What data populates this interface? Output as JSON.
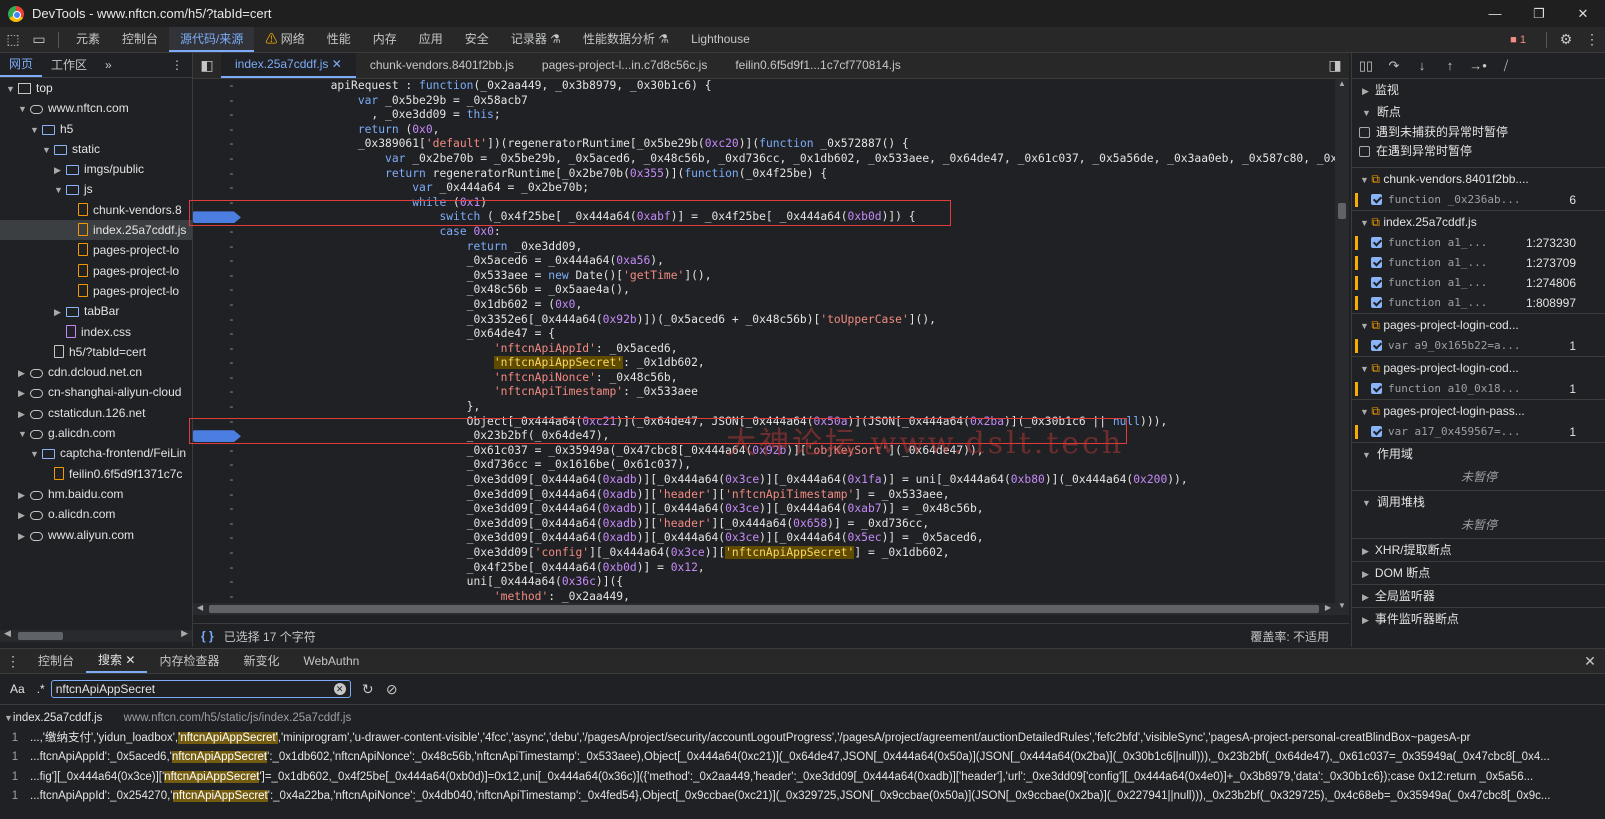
{
  "window": {
    "title": "DevTools - www.nftcn.com/h5/?tabId=cert",
    "buttons": [
      "—",
      "❐",
      "✕"
    ]
  },
  "main_tabs": {
    "items": [
      "元素",
      "控制台",
      "源代码/来源",
      "网络",
      "性能",
      "内存",
      "应用",
      "安全",
      "记录器",
      "性能数据分析",
      "Lighthouse"
    ],
    "issues_count": "1"
  },
  "navigator": {
    "tabs": [
      "网页",
      "工作区"
    ],
    "tree": [
      {
        "label": "top",
        "indent": 0,
        "icon": "frame",
        "arrow": "▼"
      },
      {
        "label": "www.nftcn.com",
        "indent": 1,
        "icon": "cloud",
        "arrow": "▼"
      },
      {
        "label": "h5",
        "indent": 2,
        "icon": "folder",
        "arrow": "▼"
      },
      {
        "label": "static",
        "indent": 3,
        "icon": "folder",
        "arrow": "▼"
      },
      {
        "label": "imgs/public",
        "indent": 4,
        "icon": "folder",
        "arrow": "▶"
      },
      {
        "label": "js",
        "indent": 4,
        "icon": "folder",
        "arrow": "▼"
      },
      {
        "label": "chunk-vendors.8",
        "indent": 5,
        "icon": "file",
        "arrow": ""
      },
      {
        "label": "index.25a7cddf.js",
        "indent": 5,
        "icon": "file",
        "arrow": "",
        "selected": true
      },
      {
        "label": "pages-project-lo",
        "indent": 5,
        "icon": "file",
        "arrow": ""
      },
      {
        "label": "pages-project-lo",
        "indent": 5,
        "icon": "file",
        "arrow": ""
      },
      {
        "label": "pages-project-lo",
        "indent": 5,
        "icon": "file",
        "arrow": ""
      },
      {
        "label": "tabBar",
        "indent": 4,
        "icon": "folder",
        "arrow": "▶"
      },
      {
        "label": "index.css",
        "indent": 4,
        "icon": "css",
        "arrow": ""
      },
      {
        "label": "h5/?tabId=cert",
        "indent": 3,
        "icon": "doc",
        "arrow": ""
      },
      {
        "label": "cdn.dcloud.net.cn",
        "indent": 1,
        "icon": "cloud",
        "arrow": "▶"
      },
      {
        "label": "cn-shanghai-aliyun-cloud",
        "indent": 1,
        "icon": "cloud",
        "arrow": "▶"
      },
      {
        "label": "cstaticdun.126.net",
        "indent": 1,
        "icon": "cloud",
        "arrow": "▶"
      },
      {
        "label": "g.alicdn.com",
        "indent": 1,
        "icon": "cloud",
        "arrow": "▼"
      },
      {
        "label": "captcha-frontend/FeiLin",
        "indent": 2,
        "icon": "folder",
        "arrow": "▼"
      },
      {
        "label": "feilin0.6f5d9f1371c7c",
        "indent": 3,
        "icon": "file",
        "arrow": ""
      },
      {
        "label": "hm.baidu.com",
        "indent": 1,
        "icon": "cloud",
        "arrow": "▶"
      },
      {
        "label": "o.alicdn.com",
        "indent": 1,
        "icon": "cloud",
        "arrow": "▶"
      },
      {
        "label": "www.aliyun.com",
        "indent": 1,
        "icon": "cloud",
        "arrow": "▶"
      }
    ]
  },
  "editor": {
    "tabs": [
      "index.25a7cddf.js",
      "chunk-vendors.8401f2bb.js",
      "pages-project-l...in.c7d8c56c.js",
      "feilin0.6f5d9f1...1c7cf770814.js"
    ],
    "lines": [
      {
        "g": "-",
        "t": "            apiRequest : function(_0x2aa449, _0x3b8979, _0x30b1c6) {"
      },
      {
        "g": "-",
        "t": "                var _0x5be29b = _0x58acb7"
      },
      {
        "g": "-",
        "t": "                  , _0xe3dd09 = this;"
      },
      {
        "g": "-",
        "t": "                return (0x0,"
      },
      {
        "g": "-",
        "t": "                _0x389061['default'])(regeneratorRuntime[_0x5be29b(0xc20)](function _0x572887() {"
      },
      {
        "g": "-",
        "t": "                    var _0x2be70b = _0x5be29b, _0x5aced6, _0x48c56b, _0xd736cc, _0x1db602, _0x533aee, _0x64de47, _0x61c037, _0x5a56de, _0x3aa0eb, _0x587c80, _0x3b"
      },
      {
        "g": "-",
        "t": "                    return regeneratorRuntime[_0x2be70b(0x355)](function(_0x4f25be) {"
      },
      {
        "g": "-",
        "t": "                        var _0x444a64 = _0x2be70b;"
      },
      {
        "g": "-",
        "t": "                        while (0x1)"
      },
      {
        "g": "-",
        "t": "                            switch (_0x4f25be[ _0x444a64(0xabf)] = _0x4f25be[ _0x444a64(0xb0d)]) {",
        "bp": true
      },
      {
        "g": "-",
        "t": "                            case 0x0:"
      },
      {
        "g": "-",
        "t": "                                return _0xe3dd09,"
      },
      {
        "g": "-",
        "t": "                                _0x5aced6 = _0x444a64(0xa56),"
      },
      {
        "g": "-",
        "t": "                                _0x533aee = new Date()['getTime'](),"
      },
      {
        "g": "-",
        "t": "                                _0x48c56b = _0x5aae4a(),"
      },
      {
        "g": "-",
        "t": "                                _0x1db602 = (0x0,"
      },
      {
        "g": "-",
        "t": "                                _0x3352e6[_0x444a64(0x92b)])(_0x5aced6 + _0x48c56b)['toUpperCase'](),"
      },
      {
        "g": "-",
        "t": "                                _0x64de47 = {"
      },
      {
        "g": "-",
        "t": "                                    'nftcnApiAppId': _0x5aced6,"
      },
      {
        "g": "-",
        "t": "                                    'nftcnApiAppSecret': _0x1db602,"
      },
      {
        "g": "-",
        "t": "                                    'nftcnApiNonce': _0x48c56b,"
      },
      {
        "g": "-",
        "t": "                                    'nftcnApiTimestamp': _0x533aee"
      },
      {
        "g": "-",
        "t": "                                },"
      },
      {
        "g": "-",
        "t": "                                Object[_0x444a64(0xc21)](_0x64de47, JSON[_0x444a64(0x50a)](JSON[_0x444a64(0x2ba)](_0x30b1c6 || null))),"
      },
      {
        "g": "-",
        "t": "                                _0x23b2bf(_0x64de47),",
        "bp": true
      },
      {
        "g": "-",
        "t": "                                _0x61c037 = _0x35949a(_0x47cbc8[_0x444a64(0x92b)]['objKeySort'](_0x64de47)),"
      },
      {
        "g": "-",
        "t": "                                _0xd736cc = _0x1616be(_0x61c037),"
      },
      {
        "g": "-",
        "t": "                                _0xe3dd09[_0x444a64(0xadb)][_0x444a64(0x3ce)][_0x444a64(0x1fa)] = uni[_0x444a64(0xb80)](_0x444a64(0x200)),"
      },
      {
        "g": "-",
        "t": "                                _0xe3dd09[_0x444a64(0xadb)]['header']['nftcnApiTimestamp'] = _0x533aee,"
      },
      {
        "g": "-",
        "t": "                                _0xe3dd09[_0x444a64(0xadb)][_0x444a64(0x3ce)][_0x444a64(0xab7)] = _0x48c56b,"
      },
      {
        "g": "-",
        "t": "                                _0xe3dd09[_0x444a64(0xadb)]['header'][_0x444a64(0x658)] = _0xd736cc,"
      },
      {
        "g": "-",
        "t": "                                _0xe3dd09[_0x444a64(0xadb)][_0x444a64(0x3ce)][_0x444a64(0x5ec)] = _0x5aced6,"
      },
      {
        "g": "-",
        "t": "                                _0xe3dd09['config'][_0x444a64(0x3ce)]['nftcnApiAppSecret'] = _0x1db602,"
      },
      {
        "g": "-",
        "t": "                                _0x4f25be[_0x444a64(0xb0d)] = 0x12,"
      },
      {
        "g": "-",
        "t": "                                uni[_0x444a64(0x36c)]({"
      },
      {
        "g": "-",
        "t": "                                    'method': _0x2aa449,"
      }
    ],
    "watermark": "大神论坛  www.dslt.tech",
    "status_left": "已选择 17 个字符",
    "status_right": "覆盖率: 不适用"
  },
  "debugger": {
    "watch_label": "监视",
    "breakpoints_label": "断点",
    "pause_uncaught": "遇到未捕获的异常时暂停",
    "pause_caught": "在遇到异常时暂停",
    "bp_files": [
      {
        "file": "chunk-vendors.8401f2bb....",
        "lines": [
          {
            "code": "function _0x236ab...",
            "ln": "6"
          }
        ]
      },
      {
        "file": "index.25a7cddf.js",
        "lines": [
          {
            "code": "function a1_...",
            "ln": "1:273230"
          },
          {
            "code": "function a1_...",
            "ln": "1:273709"
          },
          {
            "code": "function a1_...",
            "ln": "1:274806"
          },
          {
            "code": "function a1_...",
            "ln": "1:808997"
          }
        ]
      },
      {
        "file": "pages-project-login-cod...",
        "lines": [
          {
            "code": "var a9_0x165b22=a...",
            "ln": "1"
          }
        ]
      },
      {
        "file": "pages-project-login-cod...",
        "lines": [
          {
            "code": "function a10_0x18...",
            "ln": "1"
          }
        ]
      },
      {
        "file": "pages-project-login-pass...",
        "lines": [
          {
            "code": "var a17_0x459567=...",
            "ln": "1"
          }
        ]
      }
    ],
    "scope_label": "作用域",
    "not_paused_1": "未暂停",
    "callstack_label": "调用堆栈",
    "not_paused_2": "未暂停",
    "xhr_label": "XHR/提取断点",
    "dom_label": "DOM 断点",
    "global_label": "全局监听器",
    "event_label": "事件监听器断点"
  },
  "drawer": {
    "tabs": [
      "控制台",
      "搜索",
      "内存检查器",
      "新变化",
      "WebAuthn"
    ],
    "search_value": "nftcnApiAppSecret",
    "match_case": "Aa",
    "regex": ".*",
    "result_file": "index.25a7cddf.js",
    "result_path": "www.nftcn.com/h5/static/js/index.25a7cddf.js",
    "results": [
      {
        "n": "1",
        "pre": "...,'缴纳支付','yidun_loadbox',",
        "m": "'nftcnApiAppSecret'",
        "post": ",'miniprogram','u-drawer-content-visible','4fcc','async','debu','/pagesA/project/security/accountLogoutProgress','/pagesA/project/agreement/auctionDetailedRules','fefc2bfd','visibleSync','pagesA-project-personal-creatBlindBox~pagesA-pr"
      },
      {
        "n": "1",
        "pre": "...ftcnApiAppId':_0x5aced6,'",
        "m": "nftcnApiAppSecret",
        "post": "':_0x1db602,'nftcnApiNonce':_0x48c56b,'nftcnApiTimestamp':_0x533aee),Object[_0x444a64(0xc21)](_0x64de47,JSON[_0x444a64(0x50a)](JSON[_0x444a64(0x2ba)](_0x30b1c6||null))),_0x23b2bf(_0x64de47),_0x61c037=_0x35949a(_0x47cbc8[_0x4..."
      },
      {
        "n": "1",
        "pre": "...fig'][_0x444a64(0x3ce)]['",
        "m": "nftcnApiAppSecret",
        "post": "']=_0x1db602,_0x4f25be[_0x444a64(0xb0d)]=0x12,uni[_0x444a64(0x36c)]({'method':_0x2aa449,'header':_0xe3dd09[_0x444a64(0xadb)]['header'],'url':_0xe3dd09['config'][_0x444a64(0x4e0)]+_0x3b8979,'data':_0x30b1c6});case 0x12:return _0x5a56..."
      },
      {
        "n": "1",
        "pre": "...ftcnApiAppId':_0x254270,'",
        "m": "nftcnApiAppSecret",
        "post": "':_0x4a22ba,'nftcnApiNonce':_0x4db040,'nftcnApiTimestamp':_0x4fed54},Object[_0x9ccbae(0xc21)](_0x329725,JSON[_0x9ccbae(0x50a)](JSON[_0x9ccbae(0x2ba)](_0x227941||null))),_0x23b2bf(_0x329725),_0x4c68eb=_0x35949a(_0x47cbc8[_0x9c..."
      }
    ]
  }
}
